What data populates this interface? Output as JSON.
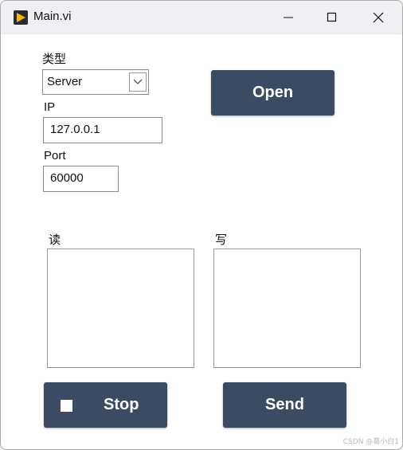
{
  "window": {
    "title": "Main.vi",
    "controls": {
      "minimize_icon": "minimize-icon",
      "maximize_icon": "maximize-icon",
      "close_icon": "close-icon"
    }
  },
  "form": {
    "type_label": "类型",
    "type_value": "Server",
    "ip_label": "IP",
    "ip_value": "127.0.0.1",
    "port_label": "Port",
    "port_value": "60000",
    "read_label": "读",
    "write_label": "写",
    "read_value": "",
    "write_value": ""
  },
  "buttons": {
    "open_label": "Open",
    "stop_label": "Stop",
    "send_label": "Send"
  },
  "watermark": "CSDN @葛小白1",
  "colors": {
    "button_bg": "#3b4b61",
    "titlebar_bg": "#eef0f3",
    "app_icon_accent": "#f5b800"
  }
}
